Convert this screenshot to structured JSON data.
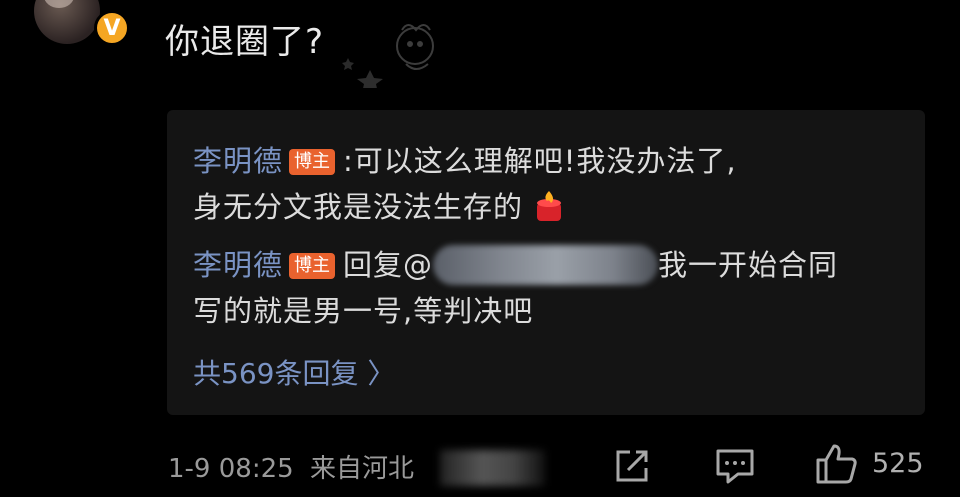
{
  "comment": {
    "verified_badge": "V",
    "text": "你退圈了?"
  },
  "replies": [
    {
      "username": "李明德",
      "tag": "博主",
      "text_line1": ":可以这么理解吧!我没办法了,",
      "text_line2": "身无分文我是没法生存的"
    },
    {
      "username": "李明德",
      "tag": "博主",
      "reply_prefix": "回复@",
      "text_line1_end": "我一开始合同",
      "text_line2": "写的就是男一号,等判决吧"
    }
  ],
  "view_more": "共569条回复 〉",
  "footer": {
    "timestamp": "1-9 08:25",
    "location": "来自河北",
    "like_count": "525"
  },
  "icons": [
    "verified-icon",
    "fire-emoji-icon",
    "share-icon",
    "comment-icon",
    "like-icon"
  ]
}
